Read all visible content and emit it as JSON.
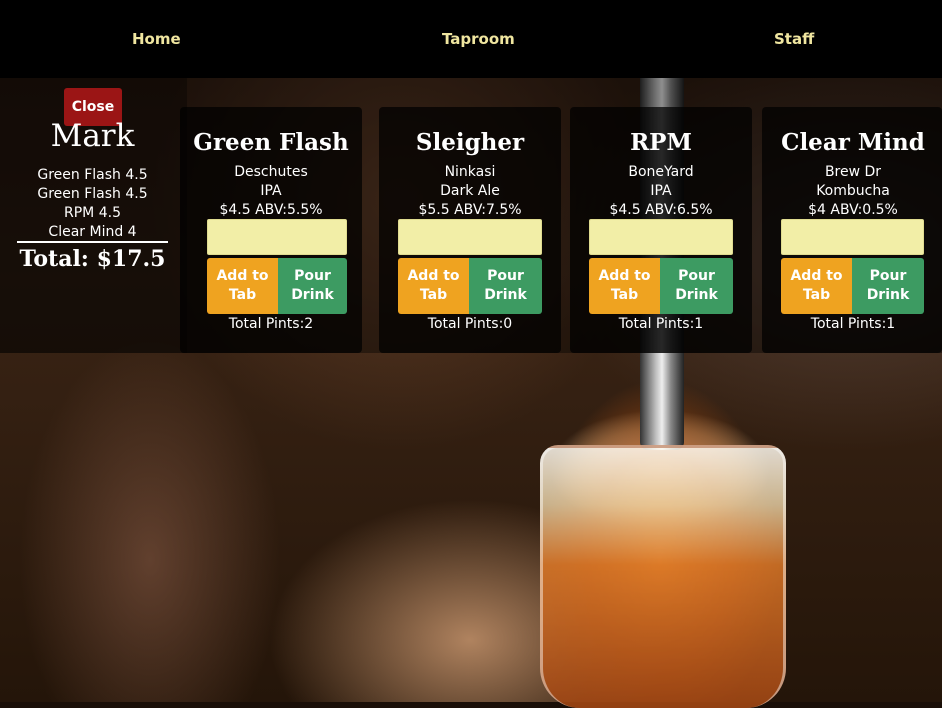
{
  "nav": {
    "items": [
      {
        "label": "Home"
      },
      {
        "label": "Taproom"
      },
      {
        "label": "Staff"
      }
    ],
    "link_color": "#f0e6a0"
  },
  "tab": {
    "close_label": "Close",
    "customer": "Mark",
    "items": [
      "Green Flash 4.5",
      "Green Flash 4.5",
      "RPM 4.5",
      "Clear Mind 4"
    ],
    "total": "Total: $17.5"
  },
  "beers": [
    {
      "name": "Green Flash",
      "brewery": "Deschutes",
      "style": "IPA",
      "price_abv": "$4.5 ABV:5.5%",
      "add_label_1": "Add to",
      "add_label_2": "Tab",
      "pour_label_1": "Pour",
      "pour_label_2": "Drink",
      "pints": "Total Pints:2"
    },
    {
      "name": "Sleigher",
      "brewery": "Ninkasi",
      "style": "Dark Ale",
      "price_abv": "$5.5 ABV:7.5%",
      "add_label_1": "Add to",
      "add_label_2": "Tab",
      "pour_label_1": "Pour",
      "pour_label_2": "Drink",
      "pints": "Total Pints:0"
    },
    {
      "name": "RPM",
      "brewery": "BoneYard",
      "style": "IPA",
      "price_abv": "$4.5 ABV:6.5%",
      "add_label_1": "Add to",
      "add_label_2": "Tab",
      "pour_label_1": "Pour",
      "pour_label_2": "Drink",
      "pints": "Total Pints:1"
    },
    {
      "name": "Clear Mind",
      "brewery": "Brew Dr",
      "style": "Kombucha",
      "price_abv": "$4 ABV:0.5%",
      "add_label_1": "Add to",
      "add_label_2": "Tab",
      "pour_label_1": "Pour",
      "pour_label_2": "Drink",
      "pints": "Total Pints:1"
    }
  ],
  "colors": {
    "close": "#9b1515",
    "add_to_tab": "#efa320",
    "pour_drink": "#3d9b62",
    "input": "#f2eea7"
  }
}
